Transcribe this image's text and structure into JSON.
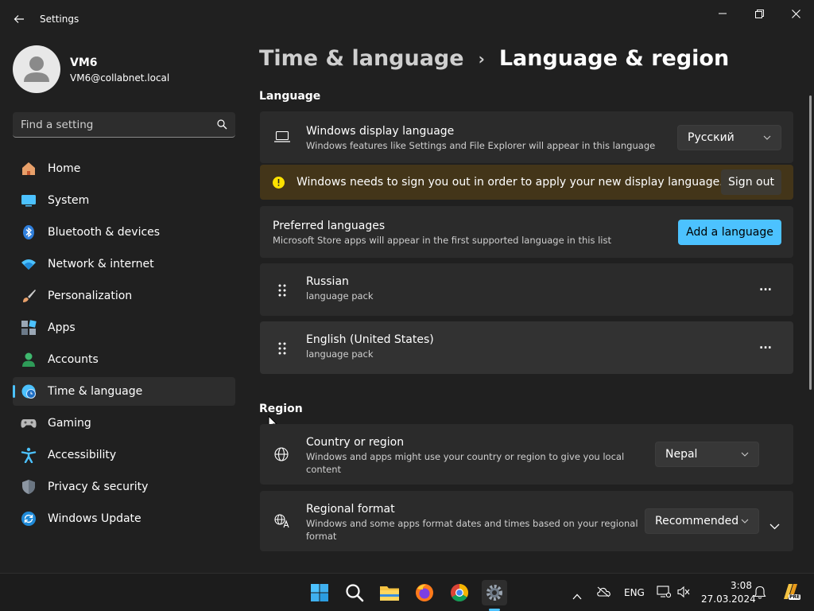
{
  "window": {
    "title": "Settings"
  },
  "profile": {
    "name": "VM6",
    "email": "VM6@collabnet.local"
  },
  "search": {
    "placeholder": "Find a setting"
  },
  "sidebar": {
    "items": [
      {
        "label": "Home",
        "icon": "home-icon"
      },
      {
        "label": "System",
        "icon": "system-icon"
      },
      {
        "label": "Bluetooth & devices",
        "icon": "bluetooth-icon"
      },
      {
        "label": "Network & internet",
        "icon": "wifi-icon"
      },
      {
        "label": "Personalization",
        "icon": "brush-icon"
      },
      {
        "label": "Apps",
        "icon": "apps-icon"
      },
      {
        "label": "Accounts",
        "icon": "accounts-icon"
      },
      {
        "label": "Time & language",
        "icon": "clock-globe-icon",
        "active": true
      },
      {
        "label": "Gaming",
        "icon": "gamepad-icon"
      },
      {
        "label": "Accessibility",
        "icon": "accessibility-icon"
      },
      {
        "label": "Privacy & security",
        "icon": "shield-icon"
      },
      {
        "label": "Windows Update",
        "icon": "update-icon"
      }
    ]
  },
  "breadcrumb": {
    "parent": "Time & language",
    "separator": "›",
    "current": "Language & region"
  },
  "language": {
    "section_title": "Language",
    "display": {
      "title": "Windows display language",
      "desc": "Windows features like Settings and File Explorer will appear in this language",
      "value": "Русский"
    },
    "warning": {
      "text": "Windows needs to sign you out in order to apply your new display language.",
      "button": "Sign out"
    },
    "preferred": {
      "title": "Preferred languages",
      "desc": "Microsoft Store apps will appear in the first supported language in this list",
      "button": "Add a language"
    },
    "list": [
      {
        "name": "Russian",
        "detail": "language pack",
        "more": "..."
      },
      {
        "name": "English (United States)",
        "detail": "language pack",
        "more": "..."
      }
    ]
  },
  "region": {
    "section_title": "Region",
    "country": {
      "title": "Country or region",
      "desc_line1": "Windows and apps might use your country or region to give you local",
      "desc_line2": "content",
      "value": "Nepal"
    },
    "format": {
      "title": "Regional format",
      "desc_line1": "Windows and some apps format dates and times based on your regional",
      "desc_line2": "format",
      "value": "Recommended"
    }
  },
  "taskbar": {
    "lang": "ENG",
    "time": "3:08",
    "date": "27.03.2024",
    "pre_badge": "PRE"
  },
  "colors": {
    "accent": "#4cc2ff",
    "warning_bg": "#433519",
    "warning_icon": "#fce100",
    "card_bg": "#2b2b2b",
    "window_bg": "#202020"
  }
}
